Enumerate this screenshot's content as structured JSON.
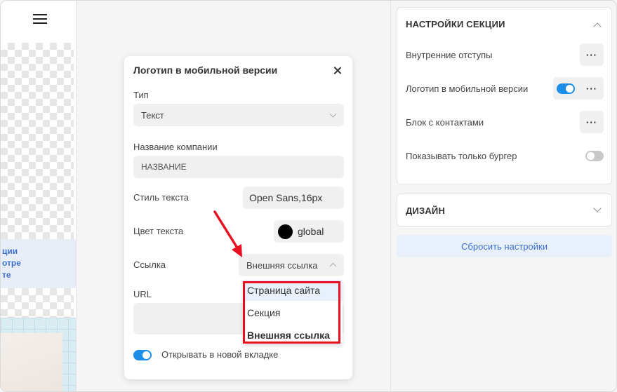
{
  "preview": {
    "menu_icon": "hamburger-icon",
    "banner_lines": [
      "ции",
      "отре",
      "те"
    ]
  },
  "modal": {
    "title": "Логотип в мобильной версии",
    "close_icon": "close-icon",
    "type_label": "Тип",
    "type_value": "Текст",
    "company_label": "Название компании",
    "company_value": "НАЗВАНИЕ",
    "text_style_label": "Стиль текста",
    "text_style_value": "Open Sans,16px",
    "text_color_label": "Цвет текста",
    "text_color_value": "global",
    "text_color_swatch": "#000000",
    "link_label": "Ссылка",
    "link_value": "Внешняя ссылка",
    "link_options": [
      "Страница сайта",
      "Секция",
      "Внешняя ссылка"
    ],
    "url_label": "URL",
    "new_tab_label": "Открывать в новой вкладке",
    "new_tab_on": true
  },
  "annotation": {
    "arrow_color": "#e8101e",
    "box_color": "#e8101e"
  },
  "settings": {
    "section_title": "НАСТРОЙКИ СЕКЦИИ",
    "rows": [
      {
        "label": "Внутренние отступы"
      },
      {
        "label": "Логотип в мобильной версии",
        "toggle_on": true
      },
      {
        "label": "Блок с контактами"
      },
      {
        "label": "Показывать только бургер",
        "toggle_on": false
      }
    ],
    "more_symbol": "···",
    "design_title": "ДИЗАЙН",
    "reset_label": "Сбросить настройки"
  },
  "colors": {
    "accent": "#1d8ee8",
    "link_blue": "#3d6fd1",
    "field_bg": "#f0f0f0",
    "panel_bg": "#f5f5f5"
  }
}
